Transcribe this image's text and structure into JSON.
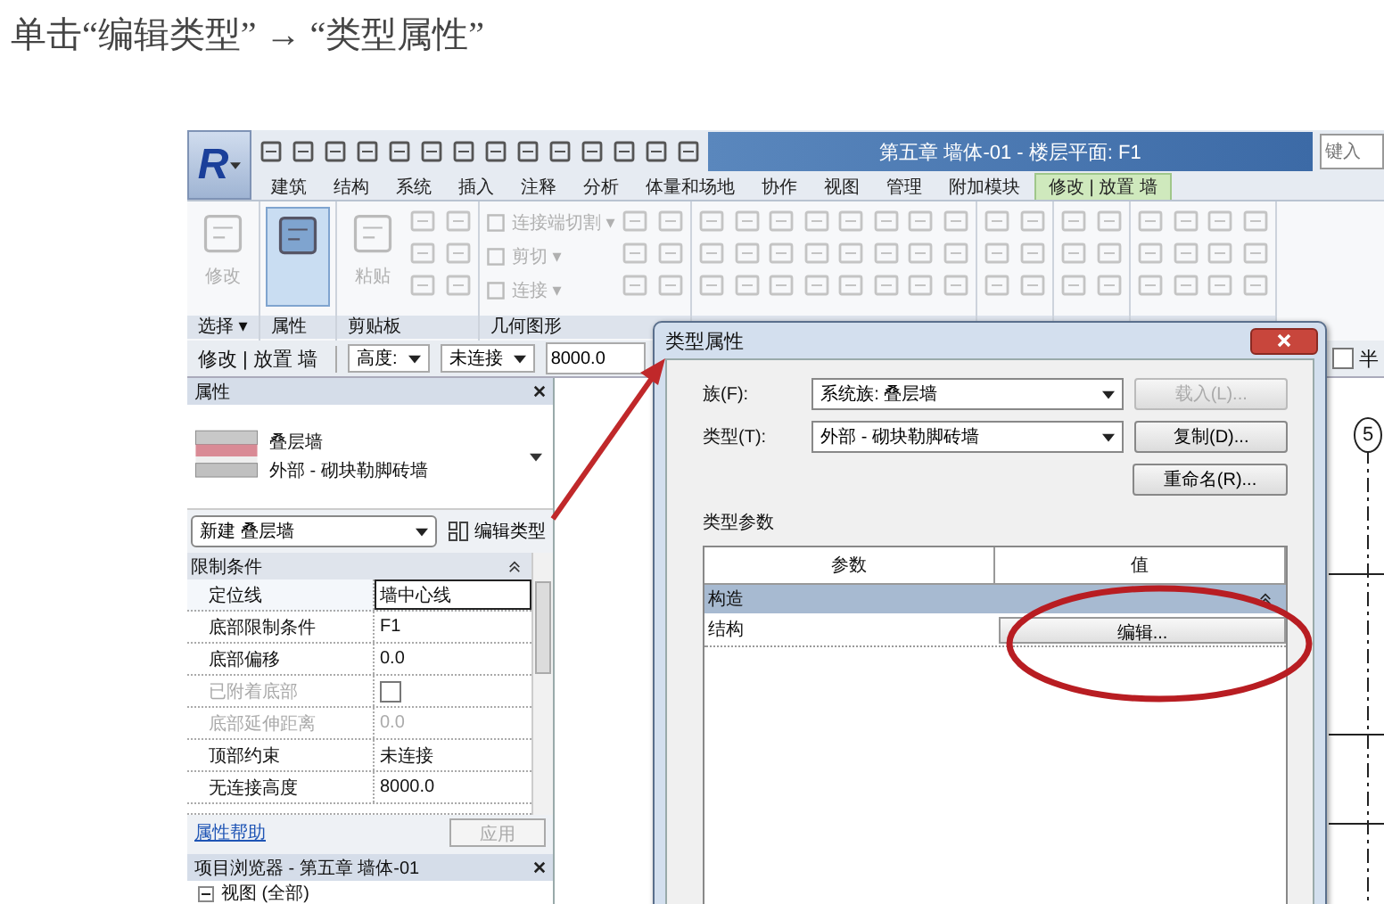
{
  "caption": "单击“编辑类型” → “类型属性”",
  "app": {
    "logo": "R",
    "title": "第五章 墙体-01 - 楼层平面: F1",
    "search": {
      "placeholder": "键入"
    }
  },
  "ribbon_tabs": [
    {
      "label": "建筑",
      "selected": false
    },
    {
      "label": "结构",
      "selected": false
    },
    {
      "label": "系统",
      "selected": false
    },
    {
      "label": "插入",
      "selected": false
    },
    {
      "label": "注释",
      "selected": false
    },
    {
      "label": "分析",
      "selected": false
    },
    {
      "label": "体量和场地",
      "selected": false
    },
    {
      "label": "协作",
      "selected": false
    },
    {
      "label": "视图",
      "selected": false
    },
    {
      "label": "管理",
      "selected": false
    },
    {
      "label": "附加模块",
      "selected": false
    },
    {
      "label": "修改 | 放置 墙",
      "selected": true
    }
  ],
  "ribbon_panels": [
    {
      "label": "选择 ▾",
      "tools": [
        {
          "kind": "large",
          "label": "修改",
          "disabled": true,
          "selected": false
        }
      ]
    },
    {
      "label": "属性",
      "tools": [
        {
          "kind": "large",
          "disabled": false,
          "selected": true
        }
      ]
    },
    {
      "label": "剪贴板",
      "tools": [
        {
          "kind": "large",
          "label": "粘贴",
          "disabled": true,
          "selected": false
        },
        {
          "kind": "icons",
          "disabled": true
        }
      ]
    },
    {
      "label": "几何图形",
      "tools": [
        {
          "kind": "small",
          "label": "连接端切割 ▾",
          "disabled": true
        },
        {
          "kind": "small",
          "label": "剪切 ▾",
          "disabled": true
        },
        {
          "kind": "small",
          "label": "连接 ▾",
          "disabled": true
        },
        {
          "kind": "icons",
          "disabled": true
        }
      ]
    },
    {
      "tools": [
        {
          "kind": "icons",
          "disabled": true
        },
        {
          "kind": "icons",
          "disabled": true
        },
        {
          "kind": "icons",
          "disabled": true
        },
        {
          "kind": "icons",
          "disabled": true
        }
      ]
    },
    {
      "tools": [
        {
          "kind": "icons",
          "disabled": true
        }
      ]
    },
    {
      "tools": [
        {
          "kind": "icons",
          "disabled": true
        }
      ]
    },
    {
      "tools": [
        {
          "kind": "icons",
          "disabled": true
        },
        {
          "kind": "icons",
          "disabled": true
        }
      ]
    }
  ],
  "options_bar": {
    "context": "修改 | 放置 墙",
    "height_mode": "高度:",
    "top_constraint": "未连接",
    "height_value": "8000.0",
    "radius": {
      "label": "半",
      "checked": false
    }
  },
  "properties": {
    "title": "属性",
    "type_name": "叠层墙",
    "type_detail": "外部 - 砌块勒脚砖墙",
    "selector": "新建 叠层墙",
    "edit_type": "编辑类型",
    "section": "限制条件",
    "rows": [
      {
        "kind": "text",
        "label": "定位线",
        "value": "墙中心线",
        "disabled": false,
        "selected": true
      },
      {
        "kind": "text",
        "label": "底部限制条件",
        "value": "F1",
        "disabled": false,
        "selected": false
      },
      {
        "kind": "text",
        "label": "底部偏移",
        "value": "0.0",
        "disabled": false,
        "selected": false
      },
      {
        "kind": "checkbox",
        "label": "已附着底部",
        "checked": false,
        "disabled": true,
        "selected": false
      },
      {
        "kind": "text",
        "label": "底部延伸距离",
        "value": "0.0",
        "disabled": true,
        "selected": false
      },
      {
        "kind": "text",
        "label": "顶部约束",
        "value": "未连接",
        "disabled": false,
        "selected": false
      },
      {
        "kind": "text",
        "label": "无连接高度",
        "value": "8000.0",
        "disabled": false,
        "selected": false
      }
    ],
    "help_link": "属性帮助",
    "apply": {
      "label": "应用",
      "disabled": true
    }
  },
  "project_browser": {
    "title": "项目浏览器 - 第五章 墙体-01",
    "items": [
      {
        "label": "视图 (全部)",
        "expanded": true
      }
    ]
  },
  "canvas": {
    "grid_marker": "5"
  },
  "dialog": {
    "title": "类型属性",
    "family_label": "族(F):",
    "family": "系统族: 叠层墙",
    "type_label": "类型(T):",
    "type": "外部 - 砌块勒脚砖墙",
    "buttons": [
      {
        "label": "载入(L)...",
        "disabled": true
      },
      {
        "label": "复制(D)...",
        "disabled": false
      },
      {
        "label": "重命名(R)...",
        "disabled": false
      }
    ],
    "params_label": "类型参数",
    "columns": [
      "参数",
      "值"
    ],
    "groups": [
      {
        "label": "构造",
        "expanded": true,
        "rows": [
          {
            "kind": "button",
            "name": "结构",
            "value": "编辑..."
          }
        ]
      }
    ]
  }
}
